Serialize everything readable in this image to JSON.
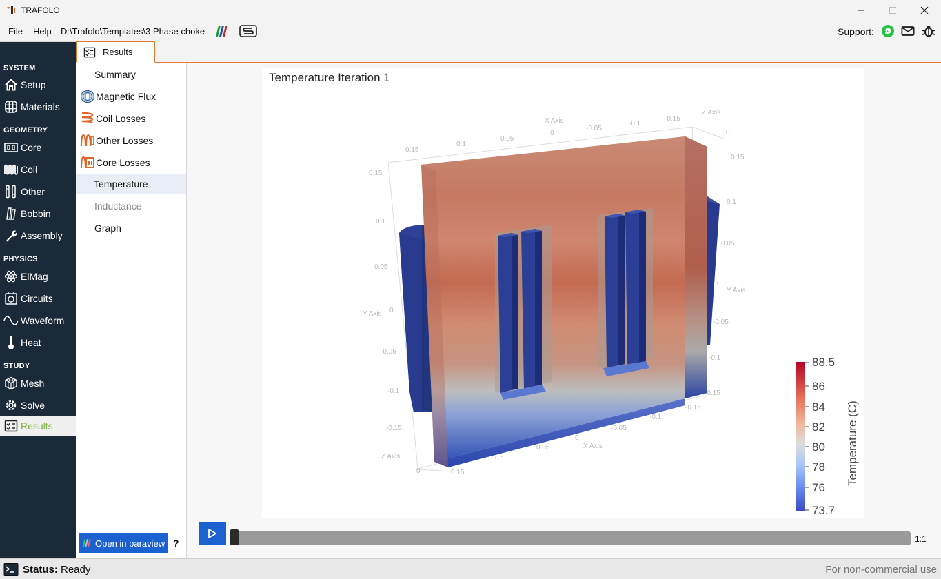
{
  "window": {
    "title": "TRAFOLO"
  },
  "menubar": {
    "file": "File",
    "help": "Help",
    "path": "D:\\Trafolo\\Templates\\3 Phase choke",
    "support_label": "Support:",
    "icons": [
      "whatsapp-icon",
      "mail-icon",
      "bug-icon"
    ]
  },
  "nav": {
    "system": "SYSTEM",
    "setup": "Setup",
    "materials": "Materials",
    "geometry": "GEOMETRY",
    "core": "Core",
    "coil": "Coil",
    "other": "Other",
    "bobbin": "Bobbin",
    "assembly": "Assembly",
    "physics": "PHYSICS",
    "elmag": "ElMag",
    "circuits": "Circuits",
    "waveform": "Waveform",
    "heat": "Heat",
    "study": "STUDY",
    "mesh": "Mesh",
    "solve": "Solve",
    "results": "Results"
  },
  "tab": {
    "label": "Results"
  },
  "subnav": {
    "summary": "Summary",
    "magnetic_flux": "Magnetic Flux",
    "coil_losses": "Coil Losses",
    "other_losses": "Other Losses",
    "core_losses": "Core Losses",
    "temperature": "Temperature",
    "inductance": "Inductance",
    "graph": "Graph"
  },
  "paraview_button": "Open in paraview",
  "help_mark": "?",
  "viewport": {
    "title": "Temperature Iteration 1",
    "colorbar": {
      "title": "Temperature (C)",
      "labels": [
        "88.5",
        "86",
        "84",
        "82",
        "80",
        "78",
        "76",
        "73.7"
      ],
      "min": 73.7,
      "max": 88.5
    },
    "axes": {
      "x_title": "X Axis",
      "y_title": "Y Axis",
      "z_title": "Z Axis",
      "x_ticks_top": [
        "0.15",
        "0.1",
        "0.05",
        "0",
        "-0.05",
        "-0.1",
        "-0.15"
      ],
      "y_ticks_left": [
        "0.15",
        "0.1",
        "0.05",
        "0",
        "-0.05",
        "-0.1",
        "-0.15"
      ],
      "y_ticks_right": [
        "0.15",
        "0.1",
        "0.05",
        "0",
        "-0.05",
        "-0.1",
        "-0.15"
      ],
      "x_ticks_bottom": [
        "0.15",
        "0.1",
        "0.05",
        "0",
        "-0.05",
        "-0.1",
        "-0.15"
      ],
      "z_top": "0",
      "z_bottom": "0"
    }
  },
  "timeline": {
    "ratio": "1:1",
    "position": 0
  },
  "status": {
    "label": "Status:",
    "value": "Ready",
    "license": "For non-commercial use"
  }
}
